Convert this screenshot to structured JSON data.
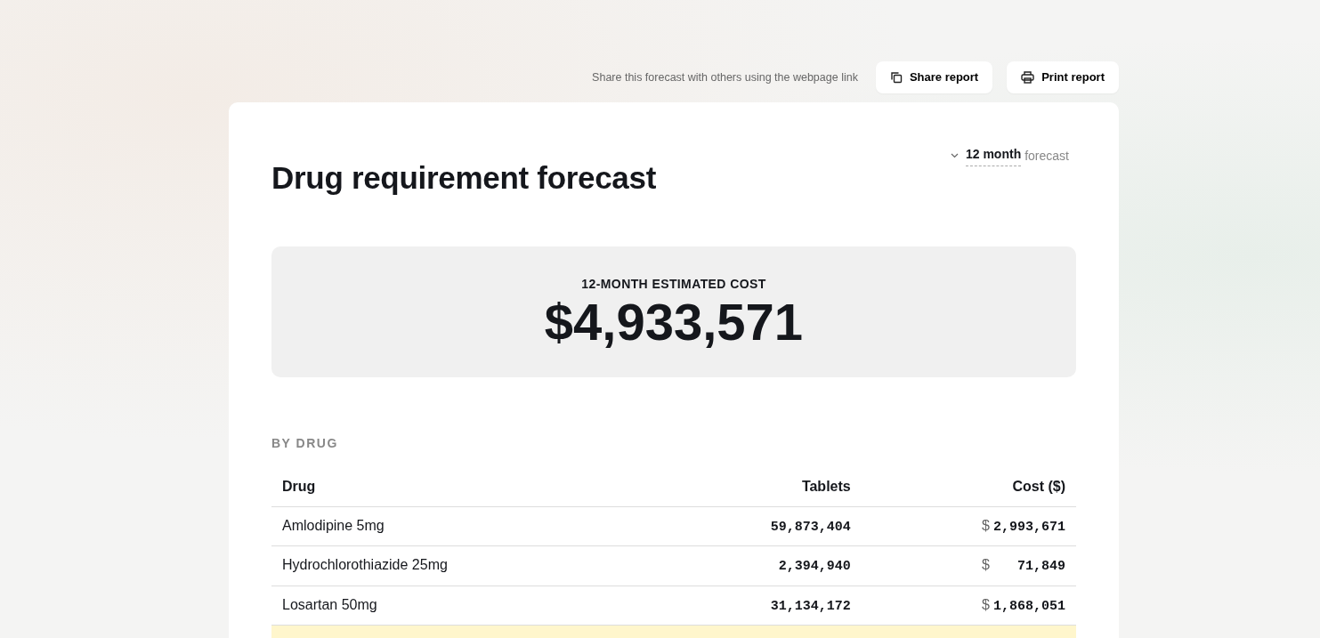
{
  "share_hint": "Share this forecast with others using the webpage link",
  "buttons": [
    {
      "kind": "share",
      "label": "Share report"
    },
    {
      "kind": "print",
      "label": "Print report"
    }
  ],
  "title": "Drug requirement forecast",
  "period": {
    "value": "12 month",
    "suffix": "forecast"
  },
  "summary": {
    "label": "12-MONTH ESTIMATED COST",
    "value": "$4,933,571"
  },
  "section_label": "BY DRUG",
  "table": {
    "columns": [
      "Drug",
      "Tablets",
      "Cost ($)"
    ],
    "rows": [
      {
        "drug": "Amlodipine 5mg",
        "tablets": "59,873,404",
        "currency": "$",
        "cost": "2,993,671"
      },
      {
        "drug": "Hydrochlorothiazide 25mg",
        "tablets": "2,394,940",
        "currency": "$",
        "cost": "71,849"
      },
      {
        "drug": "Losartan 50mg",
        "tablets": "31,134,172",
        "currency": "$",
        "cost": "1,868,051"
      }
    ],
    "total_row": {
      "highlighted": true
    }
  }
}
